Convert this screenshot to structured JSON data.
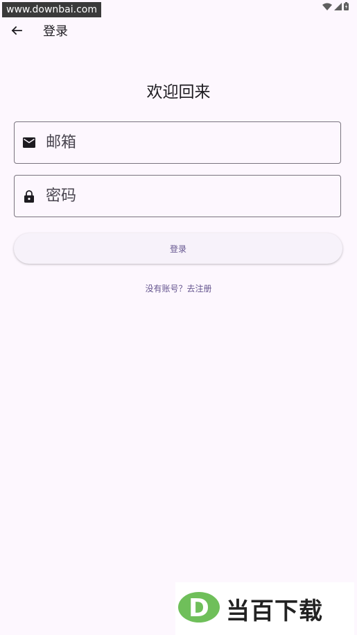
{
  "status_bar": {
    "watermark": "www.downbai.com"
  },
  "app_bar": {
    "title": "登录"
  },
  "welcome": "欢迎回来",
  "email": {
    "placeholder": "邮箱",
    "value": ""
  },
  "password": {
    "placeholder": "密码",
    "value": ""
  },
  "login_button": "登录",
  "register_link": "没有账号？去注册",
  "brand": {
    "logo_letter": "D",
    "name": "当百下载"
  },
  "colors": {
    "background": "#fdf7fe",
    "primary": "#65558f",
    "outline": "#79747e",
    "logo_green": "#6fbf5a"
  },
  "icons": [
    "wifi-icon",
    "signal-icon",
    "battery-icon",
    "back-arrow-icon",
    "mail-icon",
    "lock-icon"
  ]
}
